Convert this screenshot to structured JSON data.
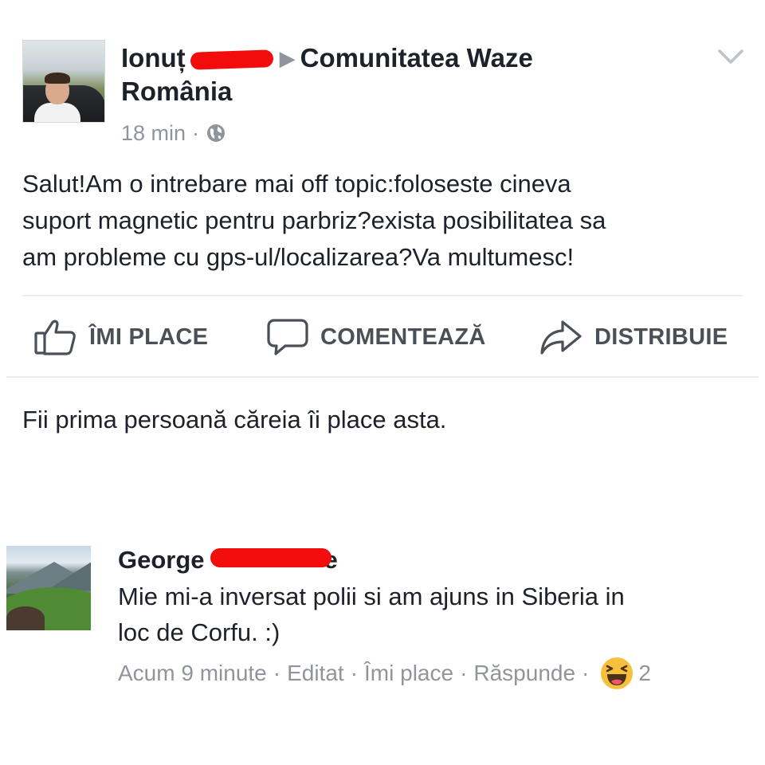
{
  "post": {
    "author": "Ionuț",
    "group": "Comunitatea Waze",
    "group_line2": "România",
    "time": "18 min",
    "meta_separator": "·",
    "body": "Salut!Am o intrebare mai off topic:foloseste cineva\nsuport magnetic pentru parbriz?exista posibilitatea sa\nam probleme cu gps-ul/localizarea?Va multumesc!",
    "icons": {
      "privacy": "globe-icon",
      "menu": "chevron-down-icon"
    }
  },
  "actions": {
    "like_label": "ÎMI PLACE",
    "comment_label": "COMENTEAZĂ",
    "share_label": "DISTRIBUIE"
  },
  "likes_summary": "Fii prima persoană căreia îi place asta.",
  "comment": {
    "author": "George",
    "author_tail": "e",
    "text": "Mie mi-a inversat polii si am ajuns in Siberia in\nloc de Corfu. :)",
    "time": "Acum 9 minute",
    "edited": "Editat",
    "like": "Îmi place",
    "reply": "Răspunde",
    "separator": "·",
    "reaction_icon": "haha-emoji-icon",
    "reaction_count": "2"
  },
  "colors": {
    "text": "#1d2129",
    "secondary": "#90949c",
    "action": "#4b4f56",
    "divider": "#e9ebee",
    "redaction": "#f20c0c",
    "haha_yellow": "#f7c03a"
  }
}
